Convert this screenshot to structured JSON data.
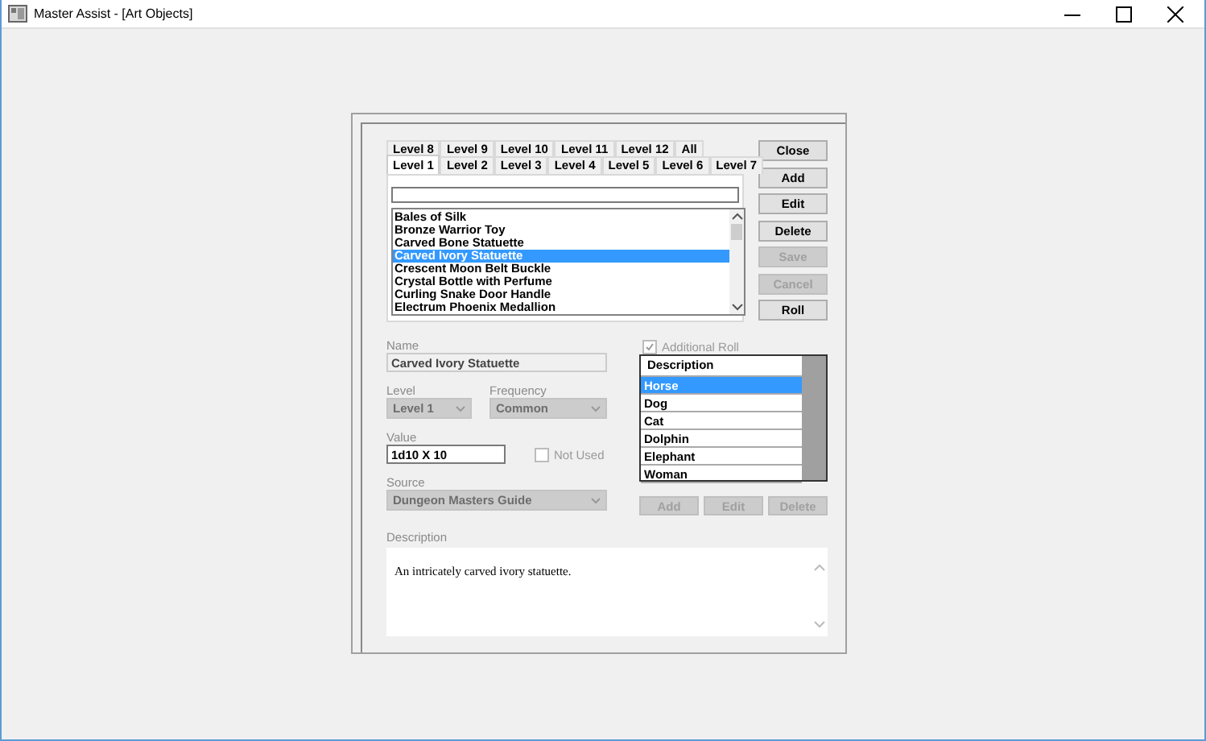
{
  "window": {
    "title": "Master Assist - [Art Objects]"
  },
  "tab_rows": [
    [
      {
        "label": "Level 8",
        "selected": false
      },
      {
        "label": "Level 9",
        "selected": false
      },
      {
        "label": "Level 10",
        "selected": false
      },
      {
        "label": "Level 11",
        "selected": false
      },
      {
        "label": "Level 12",
        "selected": false
      },
      {
        "label": "All",
        "selected": false
      }
    ],
    [
      {
        "label": "Level 1",
        "selected": true
      },
      {
        "label": "Level 2",
        "selected": false
      },
      {
        "label": "Level 3",
        "selected": false
      },
      {
        "label": "Level 4",
        "selected": false
      },
      {
        "label": "Level 5",
        "selected": false
      },
      {
        "label": "Level 6",
        "selected": false
      },
      {
        "label": "Level 7",
        "selected": false
      }
    ]
  ],
  "items": [
    {
      "label": "Bales of Silk",
      "selected": false
    },
    {
      "label": "Bronze Warrior Toy",
      "selected": false
    },
    {
      "label": "Carved Bone Statuette",
      "selected": false
    },
    {
      "label": "Carved Ivory Statuette",
      "selected": true
    },
    {
      "label": "Crescent Moon Belt Buckle",
      "selected": false
    },
    {
      "label": "Crystal Bottle with Perfume",
      "selected": false
    },
    {
      "label": "Curling Snake Door Handle",
      "selected": false
    },
    {
      "label": "Electrum Phoenix Medallion",
      "selected": false
    }
  ],
  "buttons": [
    {
      "label": "Close",
      "disabled": false
    },
    {
      "label": "Add",
      "disabled": false
    },
    {
      "label": "Edit",
      "disabled": false
    },
    {
      "label": "Delete",
      "disabled": false
    },
    {
      "label": "Save",
      "disabled": true
    },
    {
      "label": "Cancel",
      "disabled": true
    },
    {
      "label": "Roll",
      "disabled": false
    }
  ],
  "name": {
    "label": "Name",
    "value": "Carved Ivory Statuette"
  },
  "level": {
    "label": "Level",
    "value": "Level 1"
  },
  "frequency": {
    "label": "Frequency",
    "value": "Common"
  },
  "value": {
    "label": "Value",
    "value": "1d10 X 10"
  },
  "not_used": {
    "label": "Not Used",
    "checked": false
  },
  "source": {
    "label": "Source",
    "value": "Dungeon Masters Guide"
  },
  "additional_roll": {
    "label": "Additional Roll",
    "checked": true
  },
  "roll_table": {
    "header": "Description",
    "rows": [
      {
        "label": "Horse",
        "selected": true
      },
      {
        "label": "Dog",
        "selected": false
      },
      {
        "label": "Cat",
        "selected": false
      },
      {
        "label": "Dolphin",
        "selected": false
      },
      {
        "label": "Elephant",
        "selected": false
      },
      {
        "label": "Woman",
        "selected": false
      }
    ],
    "buttons": [
      {
        "label": "Add",
        "disabled": true
      },
      {
        "label": "Edit",
        "disabled": true
      },
      {
        "label": "Delete",
        "disabled": true
      }
    ]
  },
  "description": {
    "label": "Description",
    "text": "An intricately carved ivory statuette."
  }
}
